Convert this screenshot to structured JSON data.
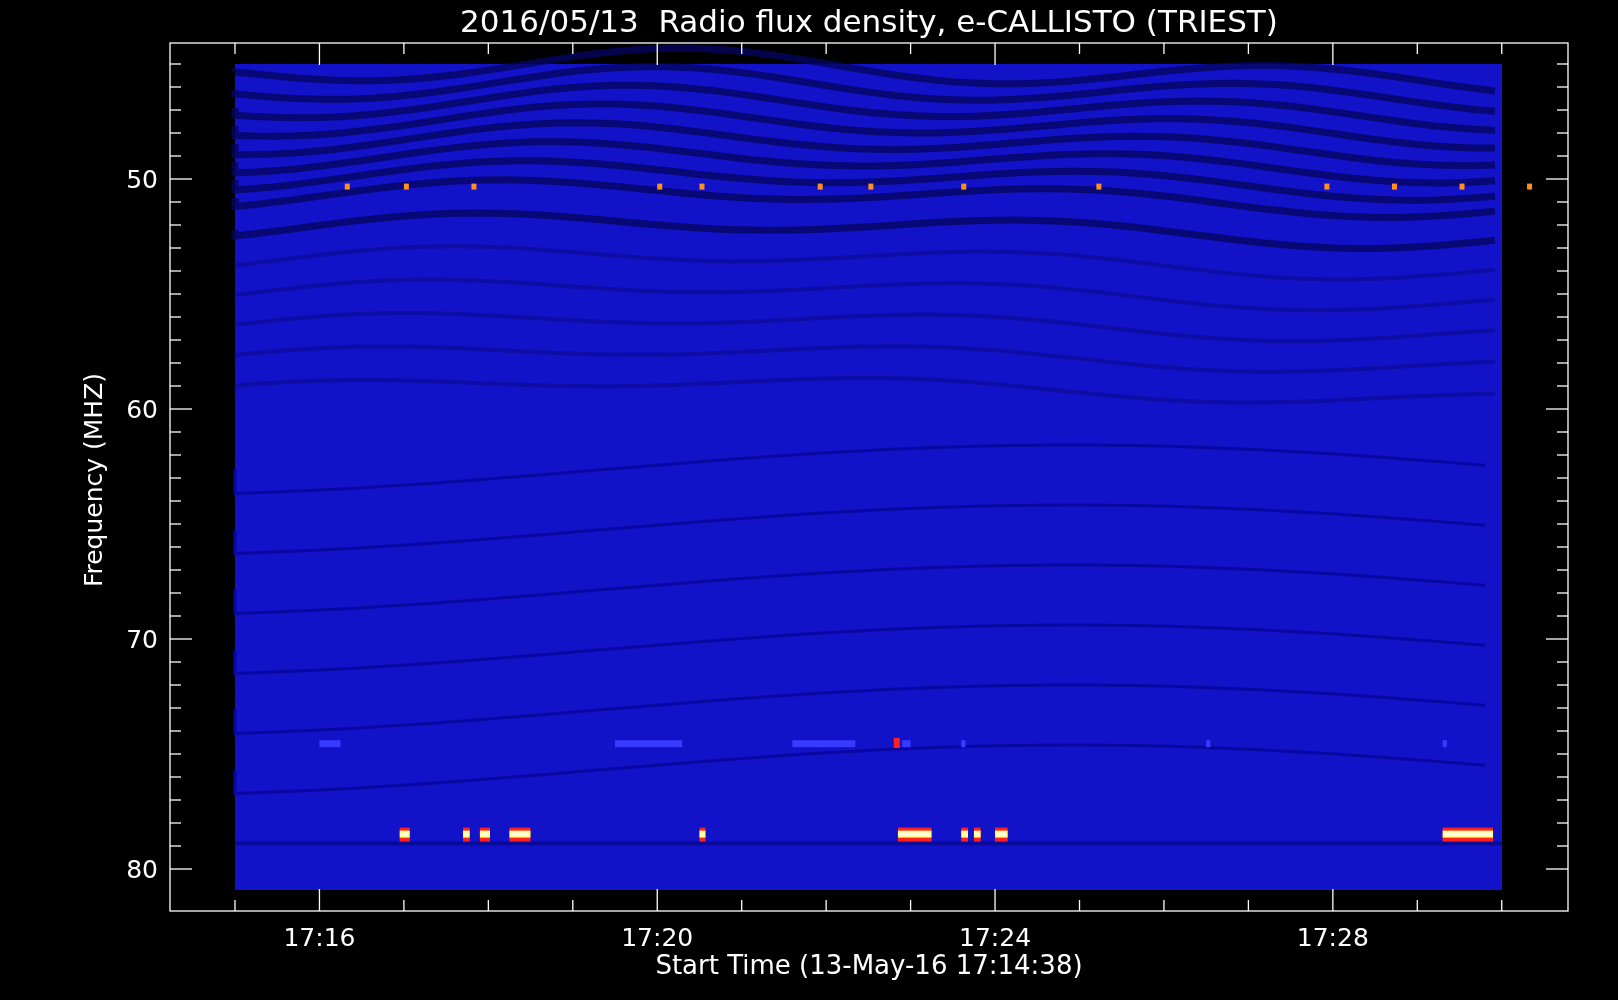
{
  "plot": {
    "title": "2016/05/13  Radio flux density, e-CALLISTO (TRIEST)",
    "xlabel": "Start Time (13-May-16 17:14:38)",
    "ylabel": "Frequency (MHZ)",
    "xticks": [
      "17:16",
      "17:20",
      "17:24",
      "17:28"
    ],
    "yticks": [
      "50",
      "60",
      "70",
      "80"
    ]
  }
}
